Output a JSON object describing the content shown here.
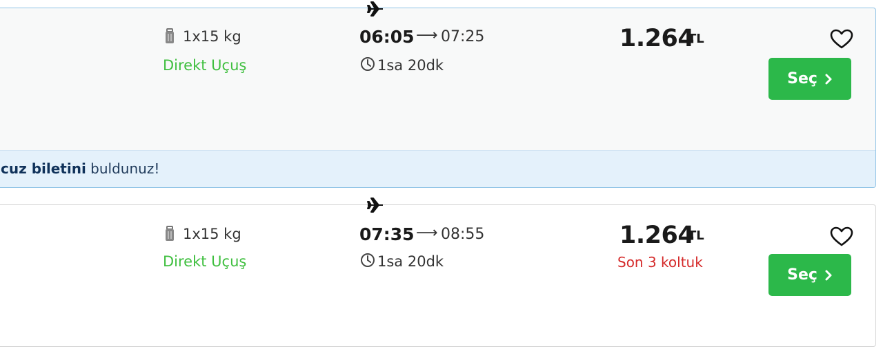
{
  "flights": [
    {
      "baggage": "1x15 kg",
      "flight_type": "Direkt Uçuş",
      "departure": "06:05",
      "arrow": "⟶",
      "arrival": "07:25",
      "duration": "1sa 20dk",
      "price": "1.264",
      "currency": "TL",
      "select_label": "Seç",
      "icons": [
        "plane-icon",
        "luggage-icon",
        "clock-icon",
        "heart-icon",
        "chevron-right-icon"
      ],
      "banner_bold": "cuz biletini",
      "banner_rest": "buldunuz!"
    },
    {
      "baggage": "1x15 kg",
      "flight_type": "Direkt Uçuş",
      "departure": "07:35",
      "arrow": "⟶",
      "arrival": "08:55",
      "duration": "1sa 20dk",
      "price": "1.264",
      "currency": "TL",
      "seats_left": "Son 3 koltuk",
      "select_label": "Seç",
      "icons": [
        "plane-icon",
        "luggage-icon",
        "clock-icon",
        "heart-icon",
        "chevron-right-icon"
      ]
    }
  ],
  "colors": {
    "accent_green": "#2cb84a",
    "direct_green": "#3fbf3f",
    "warning_red": "#d52b2b",
    "highlight_border": "#8fc3e6",
    "banner_bg": "#e4f1fb"
  }
}
